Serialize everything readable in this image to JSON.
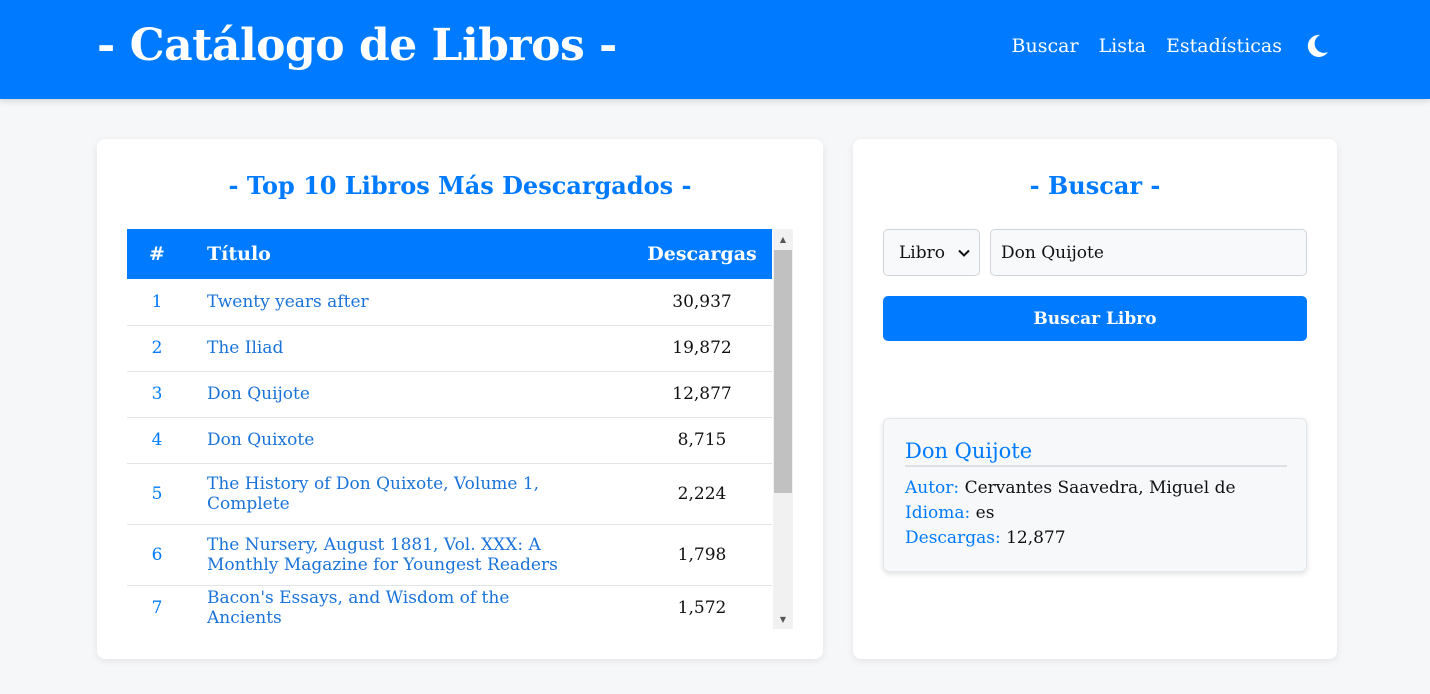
{
  "header": {
    "brand": "- Catálogo de Libros -",
    "nav": [
      "Buscar",
      "Lista",
      "Estadísticas"
    ],
    "theme_icon": "moon-icon"
  },
  "top10": {
    "title": "- Top 10 Libros Más Descargados -",
    "columns": {
      "num": "#",
      "title": "Título",
      "downloads": "Descargas"
    },
    "rows": [
      {
        "num": "1",
        "title": "Twenty years after",
        "downloads": "30,937"
      },
      {
        "num": "2",
        "title": "The Iliad",
        "downloads": "19,872"
      },
      {
        "num": "3",
        "title": "Don Quijote",
        "downloads": "12,877"
      },
      {
        "num": "4",
        "title": "Don Quixote",
        "downloads": "8,715"
      },
      {
        "num": "5",
        "title": "The History of Don Quixote, Volume 1, Complete",
        "downloads": "2,224"
      },
      {
        "num": "6",
        "title": "The Nursery, August 1881, Vol. XXX: A Monthly Magazine for Youngest Readers",
        "downloads": "1,798"
      },
      {
        "num": "7",
        "title": "Bacon's Essays, and Wisdom of the Ancients",
        "downloads": "1,572"
      }
    ]
  },
  "search": {
    "title": "- Buscar -",
    "type_selected": "Libro",
    "query": "Don Quijote",
    "button_label": "Buscar Libro"
  },
  "result": {
    "title": "Don Quijote",
    "author_label": "Autor:",
    "author": "Cervantes Saavedra, Miguel de",
    "language_label": "Idioma:",
    "language": "es",
    "downloads_label": "Descargas:",
    "downloads": "12,877"
  },
  "colors": {
    "primary": "#007bff",
    "background": "#f6f7f9"
  }
}
